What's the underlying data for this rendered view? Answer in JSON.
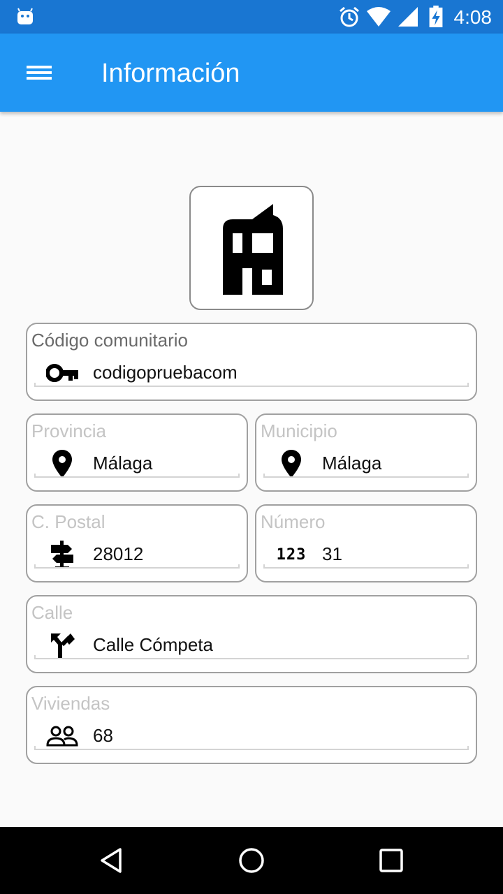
{
  "status_bar": {
    "time": "4:08"
  },
  "app_bar": {
    "title": "Información"
  },
  "fields": {
    "codigo": {
      "label": "Código comunitario",
      "value": "codigopruebacom",
      "icon": "key-icon"
    },
    "provincia": {
      "label": "Provincia",
      "value": "Málaga",
      "icon": "location-pin-icon"
    },
    "municipio": {
      "label": "Municipio",
      "value": "Málaga",
      "icon": "location-pin-icon"
    },
    "postal": {
      "label": "C. Postal",
      "value": "28012",
      "icon": "signpost-icon"
    },
    "numero": {
      "label": "Número",
      "value": "31",
      "icon": "numbers-icon",
      "icon_text": "123"
    },
    "calle": {
      "label": "Calle",
      "value": "Calle Cómpeta",
      "icon": "fork-right-icon"
    },
    "viviendas": {
      "label": "Viviendas",
      "value": "68",
      "icon": "people-icon"
    }
  },
  "colors": {
    "primary": "#2196f3",
    "status": "#1976d2",
    "border": "#a0a0a0"
  }
}
